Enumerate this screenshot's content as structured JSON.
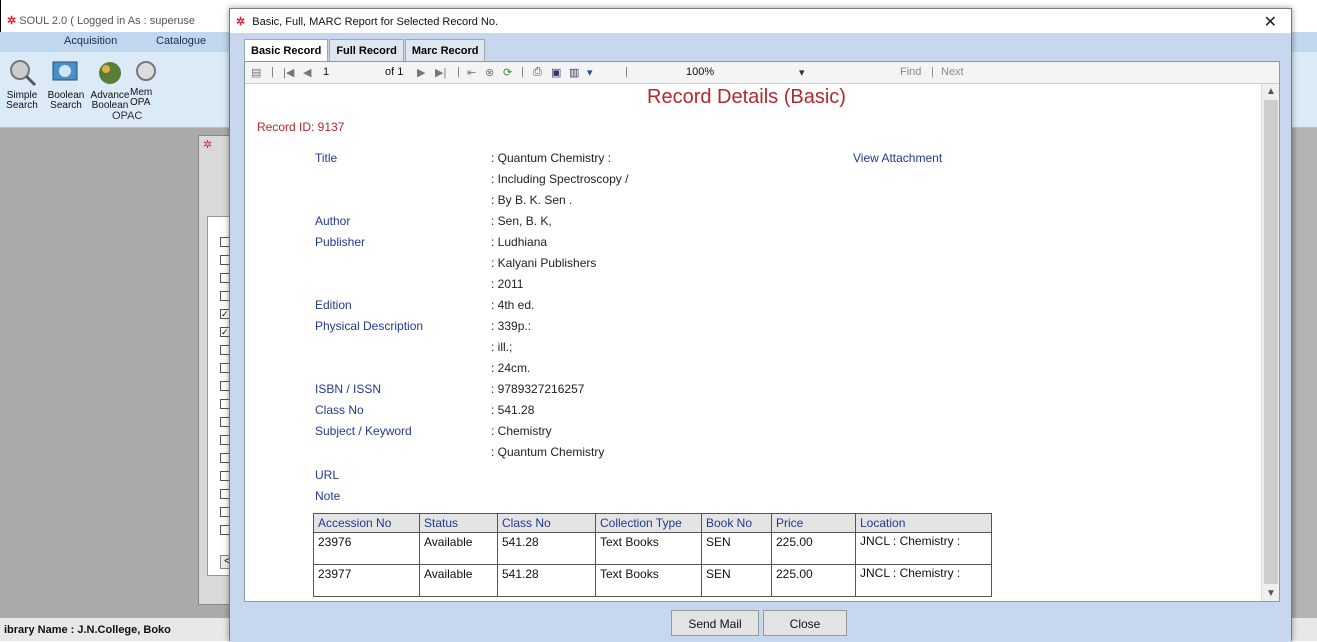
{
  "app": {
    "title": "SOUL 2.0  ( Logged in As : superuse",
    "menu": [
      "Acquisition",
      "Catalogue"
    ],
    "ribbon": [
      {
        "label": "Simple Search",
        "icon": "magnifier-icon"
      },
      {
        "label": "Boolean Search",
        "icon": "boolean-search-icon"
      },
      {
        "label": "Advance Boolean",
        "icon": "advance-boolean-icon"
      },
      {
        "label": "Mem OPA",
        "icon": "member-opac-icon"
      }
    ],
    "ribbon_group": "OPAC",
    "status": "ibrary Name : J.N.College, Boko"
  },
  "dialog": {
    "title": "Basic, Full, MARC Report for Selected Record No.",
    "close_label": "✕",
    "tabs": [
      "Basic Record",
      "Full Record",
      "Marc Record"
    ],
    "toolbar": {
      "page": "1",
      "of": "of 1",
      "zoom": "100%",
      "find": "Find",
      "next": "Next"
    },
    "buttons": {
      "send_mail": "Send Mail",
      "close": "Close"
    }
  },
  "report": {
    "heading": "Record Details (Basic)",
    "record_id": "Record ID: 9137",
    "view_attachment": "View Attachment",
    "fields": [
      {
        "label": "Title",
        "value": ": Quantum Chemistry :"
      },
      {
        "label": "",
        "value": ": Including Spectroscopy /"
      },
      {
        "label": "",
        "value": ": By B. K. Sen ."
      },
      {
        "label": "Author",
        "value": ": Sen, B. K,"
      },
      {
        "label": "Publisher",
        "value": ": Ludhiana"
      },
      {
        "label": "",
        "value": ": Kalyani Publishers"
      },
      {
        "label": "",
        "value": ": 2011"
      },
      {
        "label": "Edition",
        "value": ": 4th ed."
      },
      {
        "label": "Physical Description",
        "value": ": 339p.:"
      },
      {
        "label": "",
        "value": ": ill.;"
      },
      {
        "label": "",
        "value": ": 24cm."
      },
      {
        "label": "ISBN / ISSN",
        "value": ": 9789327216257"
      },
      {
        "label": "Class No",
        "value": ": 541.28"
      },
      {
        "label": "Subject / Keyword",
        "value": ": Chemistry"
      },
      {
        "label": "",
        "value": ": Quantum Chemistry"
      },
      {
        "label": "URL",
        "value": ""
      },
      {
        "label": "Note",
        "value": ""
      }
    ],
    "holdings": {
      "columns": [
        "Accession No",
        "Status",
        "Class No",
        "Collection Type",
        "Book No",
        "Price",
        "Location"
      ],
      "rows": [
        [
          "23976",
          "Available",
          "541.28",
          "Text Books",
          "SEN",
          "225.00",
          "JNCL : Chemistry :"
        ],
        [
          "23977",
          "Available",
          "541.28",
          "Text Books",
          "SEN",
          "225.00",
          "JNCL : Chemistry :"
        ]
      ]
    }
  }
}
